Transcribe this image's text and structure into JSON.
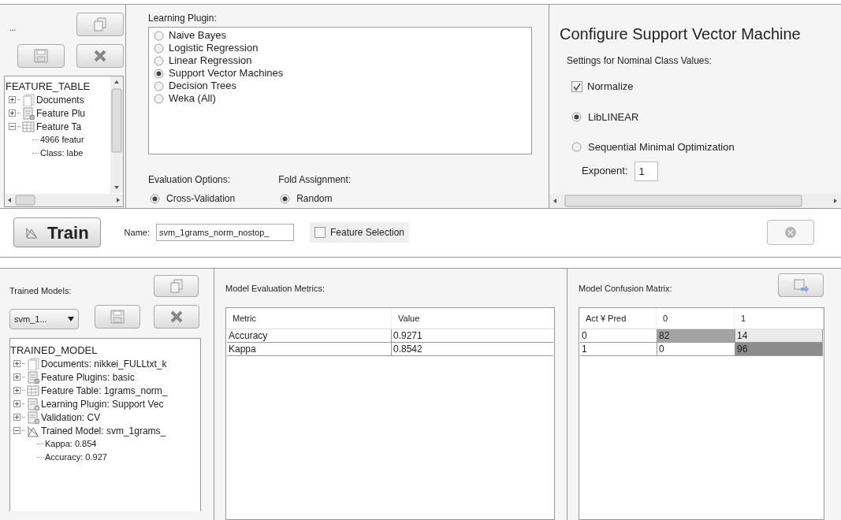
{
  "feature_panel": {
    "title": "...",
    "tree": {
      "label": "FEATURE_TABLE",
      "children": [
        {
          "label": "Documents",
          "kind": "documents",
          "expanded": false
        },
        {
          "label": "Feature Plu",
          "kind": "plugin",
          "expanded": false
        },
        {
          "label": "Feature Ta",
          "kind": "table",
          "expanded": true,
          "children": [
            {
              "label": "4966 featur"
            },
            {
              "label": "Class: labe"
            }
          ]
        }
      ]
    }
  },
  "learning_panel": {
    "title": "Learning Plugin:",
    "plugins": [
      {
        "label": "Naive Bayes",
        "selected": false
      },
      {
        "label": "Logistic Regression",
        "selected": false
      },
      {
        "label": "Linear Regression",
        "selected": false
      },
      {
        "label": "Support Vector Machines",
        "selected": true
      },
      {
        "label": "Decision Trees",
        "selected": false
      },
      {
        "label": "Weka (All)",
        "selected": false
      }
    ],
    "evaluation": {
      "label": "Evaluation Options:",
      "options": [
        {
          "label": "Cross-Validation",
          "selected": true
        }
      ]
    },
    "fold": {
      "label": "Fold Assignment:",
      "options": [
        {
          "label": "Random",
          "selected": true
        }
      ]
    }
  },
  "config_panel": {
    "title": "Configure Support Vector Machine",
    "subtitle": "Settings for Nominal Class Values:",
    "normalize": {
      "label": "Normalize",
      "checked": true
    },
    "algorithms": [
      {
        "label": "LibLINEAR",
        "selected": true
      },
      {
        "label": "Sequential Minimal Optimization",
        "selected": false
      }
    ],
    "exponent": {
      "label": "Exponent:",
      "value": "1"
    }
  },
  "train_bar": {
    "train_button": "Train",
    "name_label": "Name:",
    "name_value": "svm_1grams_norm_nostop_",
    "feature_selection": {
      "label": "Feature Selection",
      "checked": false
    },
    "stop_disabled": true
  },
  "models_panel": {
    "title": "Trained Models:",
    "dropdown": "svm_1...",
    "tree": {
      "label": "TRAINED_MODEL",
      "children": [
        {
          "label": "Documents: nikkei_FULLtxt_k",
          "kind": "documents",
          "expanded": false
        },
        {
          "label": "Feature Plugins: basic",
          "kind": "plugin",
          "expanded": false
        },
        {
          "label": "Feature Table: 1grams_norm_",
          "kind": "table",
          "expanded": false
        },
        {
          "label": "Learning Plugin: Support Vec",
          "kind": "learning",
          "expanded": false
        },
        {
          "label": "Validation: CV",
          "kind": "learning",
          "expanded": false
        },
        {
          "label": "Trained Model: svm_1grams_",
          "kind": "model",
          "expanded": true,
          "children": [
            {
              "label": "Kappa: 0.854"
            },
            {
              "label": "Accuracy: 0.927"
            }
          ]
        }
      ]
    }
  },
  "metrics_panel": {
    "title": "Model Evaluation Metrics:",
    "columns": [
      "Metric",
      "Value"
    ],
    "rows": [
      [
        "Accuracy",
        "0.9271"
      ],
      [
        "Kappa",
        "0.8542"
      ]
    ]
  },
  "confusion_panel": {
    "title": "Model Confusion Matrix:",
    "columns": [
      "Act ¥ Pred",
      "0",
      "1"
    ],
    "rows": [
      [
        {
          "text": "0",
          "color": "#ffffff"
        },
        {
          "text": "82",
          "color": "#a3a3a3"
        },
        {
          "text": "14",
          "color": "#ebebeb"
        }
      ],
      [
        {
          "text": "1",
          "color": "#ffffff"
        },
        {
          "text": "0",
          "color": "#ffffff"
        },
        {
          "text": "96",
          "color": "#8c8c8c"
        }
      ]
    ]
  }
}
